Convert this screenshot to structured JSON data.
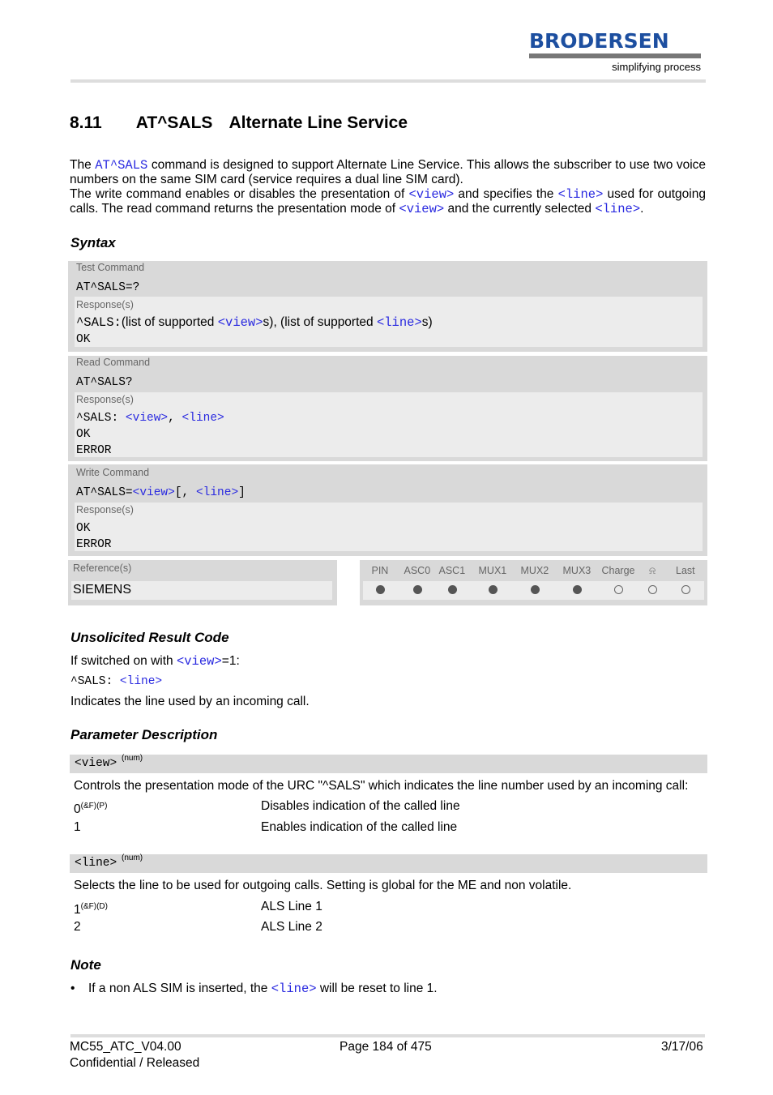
{
  "header": {
    "logo_text": "BRODERSEN",
    "logo_tagline": "simplifying process",
    "brand_color": "#1d4fa0"
  },
  "section": {
    "number": "8.11",
    "command": "AT^SALS",
    "title": "Alternate Line Service"
  },
  "intro": {
    "p1a": "The ",
    "p1cmd": "AT^SALS",
    "p1b": " command is designed to support Alternate Line Service. This allows the subscriber to use two voice numbers on the same SIM card (service requires a dual line SIM card).",
    "p2a": "The write command enables or disables the presentation of ",
    "view": "<view>",
    "p2b": " and specifies the ",
    "line": "<line>",
    "p2c": " used for outgoing calls. The read command returns the presentation mode of ",
    "p2d": " and the currently selected ",
    "p2e": "."
  },
  "syntax": {
    "heading": "Syntax",
    "test": {
      "label": "Test Command",
      "cmd": "AT^SALS=?",
      "resp_label": "Response(s)",
      "r1a": "^SALS:",
      "r1b": "(list of supported ",
      "r1c": "s), (list of supported ",
      "r1d": "s)",
      "ok": "OK"
    },
    "read": {
      "label": "Read Command",
      "cmd": "AT^SALS?",
      "resp_label": "Response(s)",
      "r1": "^SALS: ",
      "sep": ", ",
      "ok": "OK",
      "error": "ERROR"
    },
    "write": {
      "label": "Write Command",
      "cmd": "AT^SALS=",
      "bra": "[, ",
      "ket": "]",
      "resp_label": "Response(s)",
      "ok": "OK",
      "error": "ERROR"
    },
    "reference": {
      "label": "Reference(s)",
      "value": "SIEMENS"
    },
    "columns": [
      {
        "name": "PIN",
        "on": true
      },
      {
        "name": "ASC0",
        "on": true
      },
      {
        "name": "ASC1",
        "on": true
      },
      {
        "name": "MUX1",
        "on": true
      },
      {
        "name": "MUX2",
        "on": true
      },
      {
        "name": "MUX3",
        "on": true
      },
      {
        "name": "Charge",
        "on": false
      },
      {
        "name": "alarm-icon",
        "on": false
      },
      {
        "name": "Last",
        "on": false
      }
    ]
  },
  "urc": {
    "heading": "Unsolicited Result Code",
    "l1a": "If switched on with ",
    "l1b": "=1:",
    "code": "^SALS: ",
    "desc": "Indicates the line used by an incoming call."
  },
  "params": {
    "heading": "Parameter Description",
    "view": {
      "name": "<view>",
      "sup": "(num)",
      "desc": "Controls the presentation mode of the URC \"^SALS\" which indicates the line number used by an incoming call:",
      "values": [
        {
          "v": "0",
          "sup": "(&F)(P)",
          "d": "Disables indication of the called line"
        },
        {
          "v": "1",
          "sup": "",
          "d": "Enables indication of the called line"
        }
      ]
    },
    "line": {
      "name": "<line>",
      "sup": "(num)",
      "desc": "Selects the line to be used for outgoing calls. Setting is global for the ME and non volatile.",
      "values": [
        {
          "v": "1",
          "sup": "(&F)(D)",
          "d": "ALS Line 1"
        },
        {
          "v": "2",
          "sup": "",
          "d": "ALS Line 2"
        }
      ]
    }
  },
  "note": {
    "heading": "Note",
    "a": "If a non ALS SIM is inserted, the ",
    "b": " will be reset to line 1."
  },
  "footer": {
    "doc": "MC55_ATC_V04.00",
    "status": "Confidential / Released",
    "page": "Page 184 of 475",
    "date": "3/17/06"
  }
}
